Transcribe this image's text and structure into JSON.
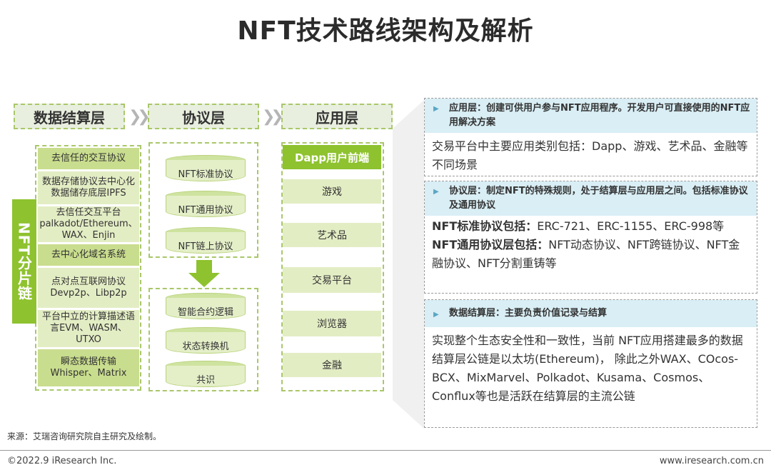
{
  "title": "NFT技术路线架构及解析",
  "layers": {
    "settlement": "数据结算层",
    "protocol": "协议层",
    "application": "应用层"
  },
  "side_label": "NFT分片链",
  "settlement_items": [
    "去信任的交互协议",
    "数据存储协议去中心化数据储存底层IPFS",
    "去信任交互平台palkadot/Ethereum、WAX、Enjin",
    "去中心化域名系统",
    "点对点互联网协议Devp2p、Libp2p",
    "平台中立的计算描述语言EVM、WASM、UTXO",
    "瞬态数据传输Whisper、Matrix"
  ],
  "protocol_top": [
    "NFT标准协议",
    "NFT通用协议",
    "NFT链上协议"
  ],
  "protocol_bottom": [
    "智能合约逻辑",
    "状态转换机",
    "共识"
  ],
  "app_header": "Dapp用户前端",
  "app_items": [
    "游戏",
    "艺术品",
    "交易平台",
    "浏览器",
    "金融"
  ],
  "panels": {
    "app": {
      "head": "应用层：创建可供用户参与NFT应用程序。开发用户可直接使用的NFT应用解决方案",
      "body": "交易平台中主要应用类别包括：Dapp、游戏、艺术品、金融等不同场景"
    },
    "protocol": {
      "head": "协议层：制定NFT的特殊规则，处于结算层与应用层之间。包括标准协议及通用协议",
      "body1_label": "NFT标准协议包括：",
      "body1_text": "ERC-721、ERC-1155、ERC-998等",
      "body2_label": "NFT通用协议层包括：",
      "body2_text": "NFT动态协议、NFT跨链协议、NFT金融协议、NFT分割重铸等"
    },
    "settlement": {
      "head": "数据结算层：主要负责价值记录与结算",
      "body": "实现整个生态安全性和一致性，当前 NFT应用搭建最多的数据结算层公链是以太坊(Ethereum)， 除此之外WAX、COcos-BCX、MixMarvel、Polkadot、Kusama、Cosmos、Conflux等也是活跃在结算层的主流公链"
    }
  },
  "source": "来源：艾瑞咨询研究院自主研究及绘制。",
  "copyright": "©2022.9 iResearch Inc.",
  "website": "www.iresearch.com.cn",
  "colors": {
    "green": "#8ec22f",
    "light_green": "#e3edc4",
    "panel_head": "#d9eef5"
  }
}
